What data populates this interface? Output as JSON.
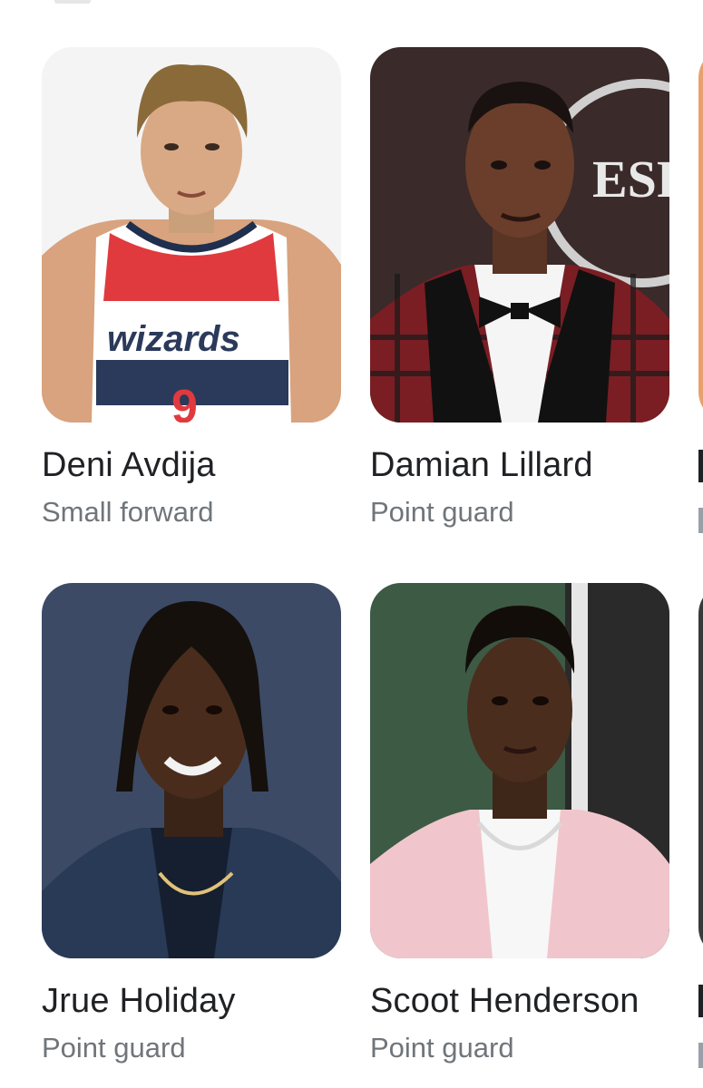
{
  "results": [
    {
      "name": "Deni Avdija",
      "position": "Small forward",
      "jersey_text": "wizards",
      "jersey_number": "9"
    },
    {
      "name": "Damian Lillard",
      "position": "Point guard",
      "backdrop_text": "ESP"
    },
    {
      "name": "Jrue Holiday",
      "position": "Point guard"
    },
    {
      "name": "Scoot Henderson",
      "position": "Point guard"
    }
  ],
  "colors": {
    "name_text": "#202124",
    "position_text": "#70757a",
    "background": "#ffffff"
  }
}
